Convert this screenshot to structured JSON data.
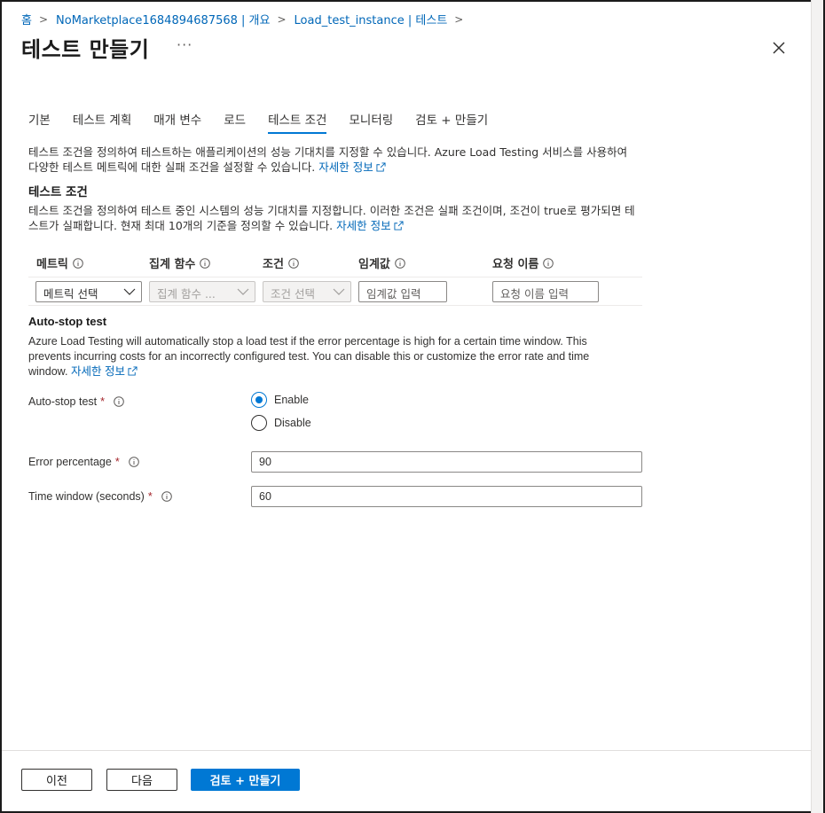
{
  "breadcrumb": {
    "home": "홈",
    "item1": "NoMarketplace1684894687568 | 개요",
    "item2": "Load_test_instance | 테스트"
  },
  "header": {
    "title": "테스트 만들기",
    "more": "···"
  },
  "tabs": [
    {
      "label": "기본"
    },
    {
      "label": "테스트 계획"
    },
    {
      "label": "매개 변수"
    },
    {
      "label": "로드"
    },
    {
      "label": "테스트 조건"
    },
    {
      "label": "모니터링"
    },
    {
      "label": "검토 + 만들기"
    }
  ],
  "intro": {
    "text": "테스트 조건을 정의하여 테스트하는 애플리케이션의 성능 기대치를 지정할 수 있습니다. Azure Load Testing 서비스를 사용하여 다양한 테스트 메트릭에 대한 실패 조건을 설정할 수 있습니다.",
    "link": "자세한 정보"
  },
  "criteria": {
    "heading": "테스트 조건",
    "desc": "테스트 조건을 정의하여 테스트 중인 시스템의 성능 기대치를 지정합니다. 이러한 조건은 실패 조건이며, 조건이 true로 평가되면 테스트가 실패합니다. 현재 최대 10개의 기준을 정의할 수 있습니다.",
    "link": "자세한 정보",
    "columns": {
      "metric": "메트릭",
      "aggregate": "집계 함수",
      "condition": "조건",
      "threshold": "임계값",
      "request": "요청 이름"
    },
    "row": {
      "metric_placeholder": "메트릭 선택",
      "aggregate_placeholder": "집계 함수 ...",
      "condition_placeholder": "조건 선택",
      "threshold_placeholder": "임계값 입력",
      "request_placeholder": "요청 이름 입력"
    }
  },
  "autostop": {
    "heading": "Auto-stop test",
    "desc": "Azure Load Testing will automatically stop a load test if the error percentage is high for a certain time window. This prevents incurring costs for an incorrectly configured test. You can disable this or customize the error rate and time window.",
    "link": "자세한 정보",
    "field_label": "Auto-stop test",
    "options": {
      "enable": "Enable",
      "disable": "Disable"
    },
    "selected": "Enable",
    "error_label": "Error percentage",
    "error_value": "90",
    "window_label": "Time window (seconds)",
    "window_value": "60",
    "required_mark": "*"
  },
  "footer": {
    "prev": "이전",
    "next": "다음",
    "review": "검토 + 만들기"
  },
  "colors": {
    "accent": "#0078d4",
    "link": "#0067b8",
    "required": "#a4262c"
  }
}
